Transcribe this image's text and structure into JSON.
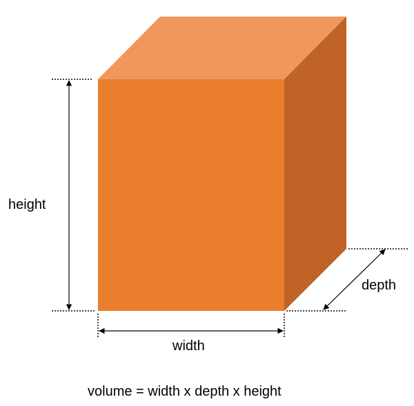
{
  "labels": {
    "height": "height",
    "width": "width",
    "depth": "depth",
    "formula": "volume = width x depth x height"
  },
  "colors": {
    "front": "#E97E2E",
    "top": "#F0975B",
    "side": "#BF6326",
    "line": "#000000"
  }
}
